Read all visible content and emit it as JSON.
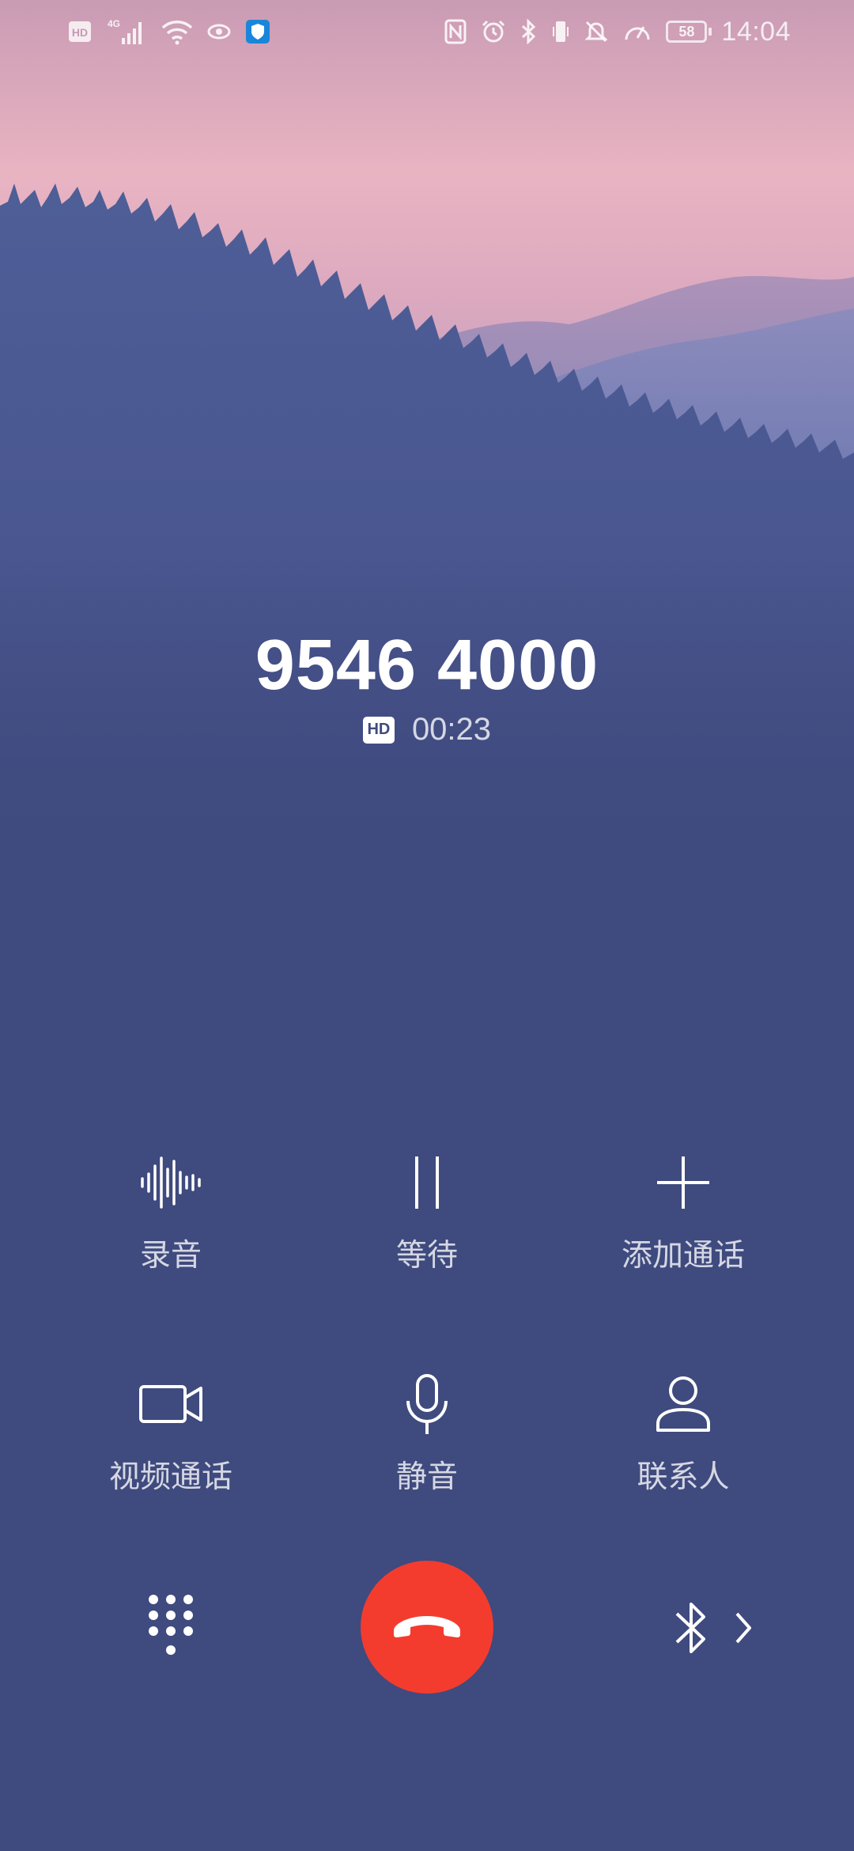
{
  "status_bar": {
    "left_icons": [
      "hd-voice-icon",
      "signal-4g-icon",
      "wifi-icon",
      "eye-comfort-icon",
      "security-shield-icon"
    ],
    "network_label": "4G",
    "hd_label": "HD",
    "right_icons": [
      "nfc-icon",
      "alarm-icon",
      "bluetooth-icon",
      "vibrate-icon",
      "mute-icon",
      "speed-icon"
    ],
    "battery": "58",
    "time": "14:04"
  },
  "call": {
    "number": "9546 4000",
    "hd_badge": "HD",
    "duration": "00:23"
  },
  "actions": [
    {
      "key": "record",
      "label": "录音",
      "icon": "waveform-icon"
    },
    {
      "key": "hold",
      "label": "等待",
      "icon": "pause-icon"
    },
    {
      "key": "add_call",
      "label": "添加通话",
      "icon": "plus-icon"
    },
    {
      "key": "video_call",
      "label": "视频通话",
      "icon": "video-camera-icon"
    },
    {
      "key": "mute",
      "label": "静音",
      "icon": "microphone-icon"
    },
    {
      "key": "contacts",
      "label": "联系人",
      "icon": "person-icon"
    }
  ],
  "bottom": {
    "dialpad_icon": "dialpad-icon",
    "end_call_icon": "hang-up-icon",
    "audio_route_icon": "bluetooth-icon",
    "chevron_icon": "chevron-right-icon"
  },
  "colors": {
    "background": "#3f4a7e",
    "sky_top": "#d7a2b7",
    "end_call": "#f33c2e"
  }
}
